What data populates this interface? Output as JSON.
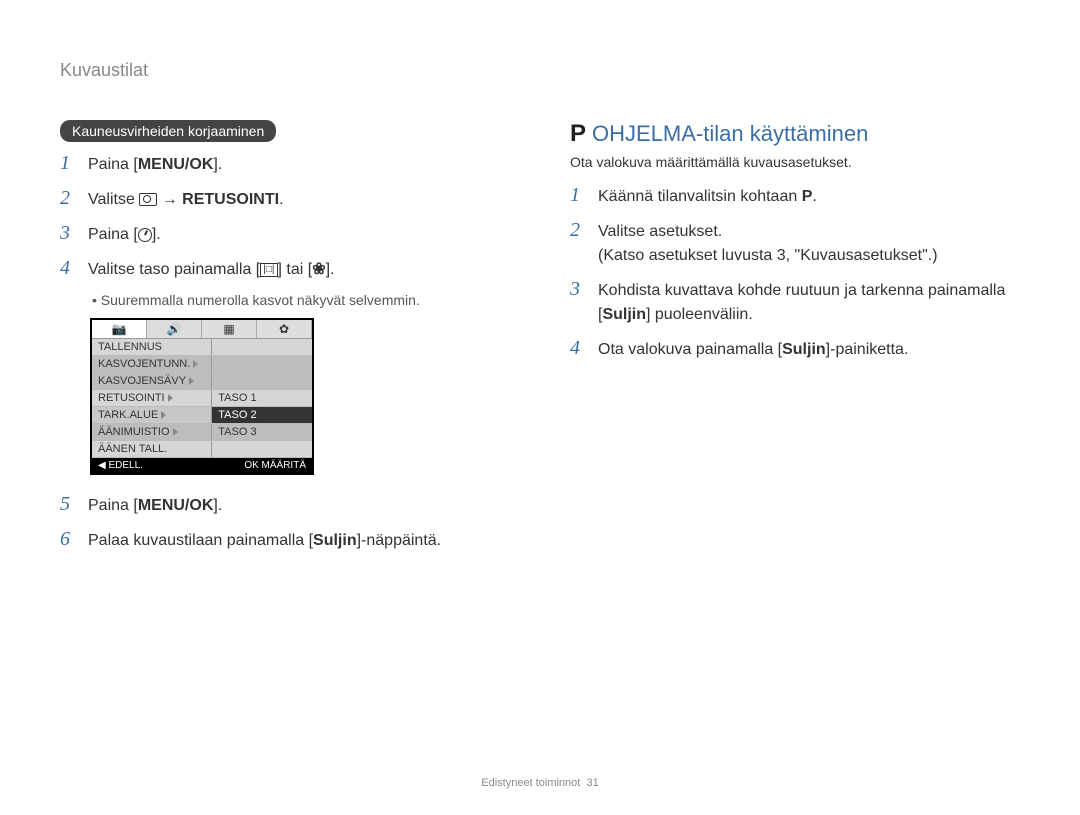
{
  "breadcrumb": "Kuvaustilat",
  "left": {
    "pill": "Kauneusvirheiden korjaaminen",
    "steps": {
      "1": {
        "pre": "Paina [",
        "bold": "MENU/OK",
        "post": "]."
      },
      "2": {
        "pre": "Valitse ",
        "icon_after": " → ",
        "bold": "RETUSOINTI",
        "post": "."
      },
      "3": {
        "pre": "Paina [",
        "post": "]."
      },
      "4": {
        "pre": "Valitse taso painamalla [",
        "mid": "] tai [",
        "post": "]."
      },
      "bullet": "Suuremmalla numerolla kasvot näkyvät selvemmin.",
      "5": {
        "pre": "Paina [",
        "bold": "MENU/OK",
        "post": "]."
      },
      "6": {
        "pre": "Palaa kuvaustilaan painamalla [",
        "bold": "Suljin",
        "post": "]-näppäintä."
      }
    },
    "menu": {
      "rows": [
        {
          "l": "TALLENNUS",
          "r": ""
        },
        {
          "l": "KASVOJENTUNN.",
          "r": ""
        },
        {
          "l": "KASVOJENSÄVY",
          "r": ""
        },
        {
          "l": "RETUSOINTI",
          "r": "TASO 1"
        },
        {
          "l": "TARK.ALUE",
          "r": "TASO 2"
        },
        {
          "l": "ÄÄNIMUISTIO",
          "r": "TASO 3"
        },
        {
          "l": "ÄÄNEN TALL.",
          "r": ""
        }
      ],
      "footer_left": "◀ EDELL.",
      "footer_right": "OK MÄÄRITÄ"
    }
  },
  "right": {
    "mode_letter": "P",
    "heading": "OHJELMA-tilan käyttäminen",
    "intro": "Ota valokuva määrittämällä kuvausasetukset.",
    "steps": {
      "1": {
        "pre": "Käännä tilanvalitsin kohtaan ",
        "bold": "P",
        "post": "."
      },
      "2": {
        "line1": "Valitse asetukset.",
        "line2": "(Katso asetukset luvusta 3, \"Kuvausasetukset\".)"
      },
      "3": {
        "pre": "Kohdista kuvattava kohde ruutuun ja tarkenna painamalla [",
        "bold": "Suljin",
        "post": "] puoleenväliin."
      },
      "4": {
        "pre": "Ota valokuva painamalla [",
        "bold": "Suljin",
        "post": "]-painiketta."
      }
    }
  },
  "footer": {
    "text": "Edistyneet toiminnot",
    "page": "31"
  }
}
